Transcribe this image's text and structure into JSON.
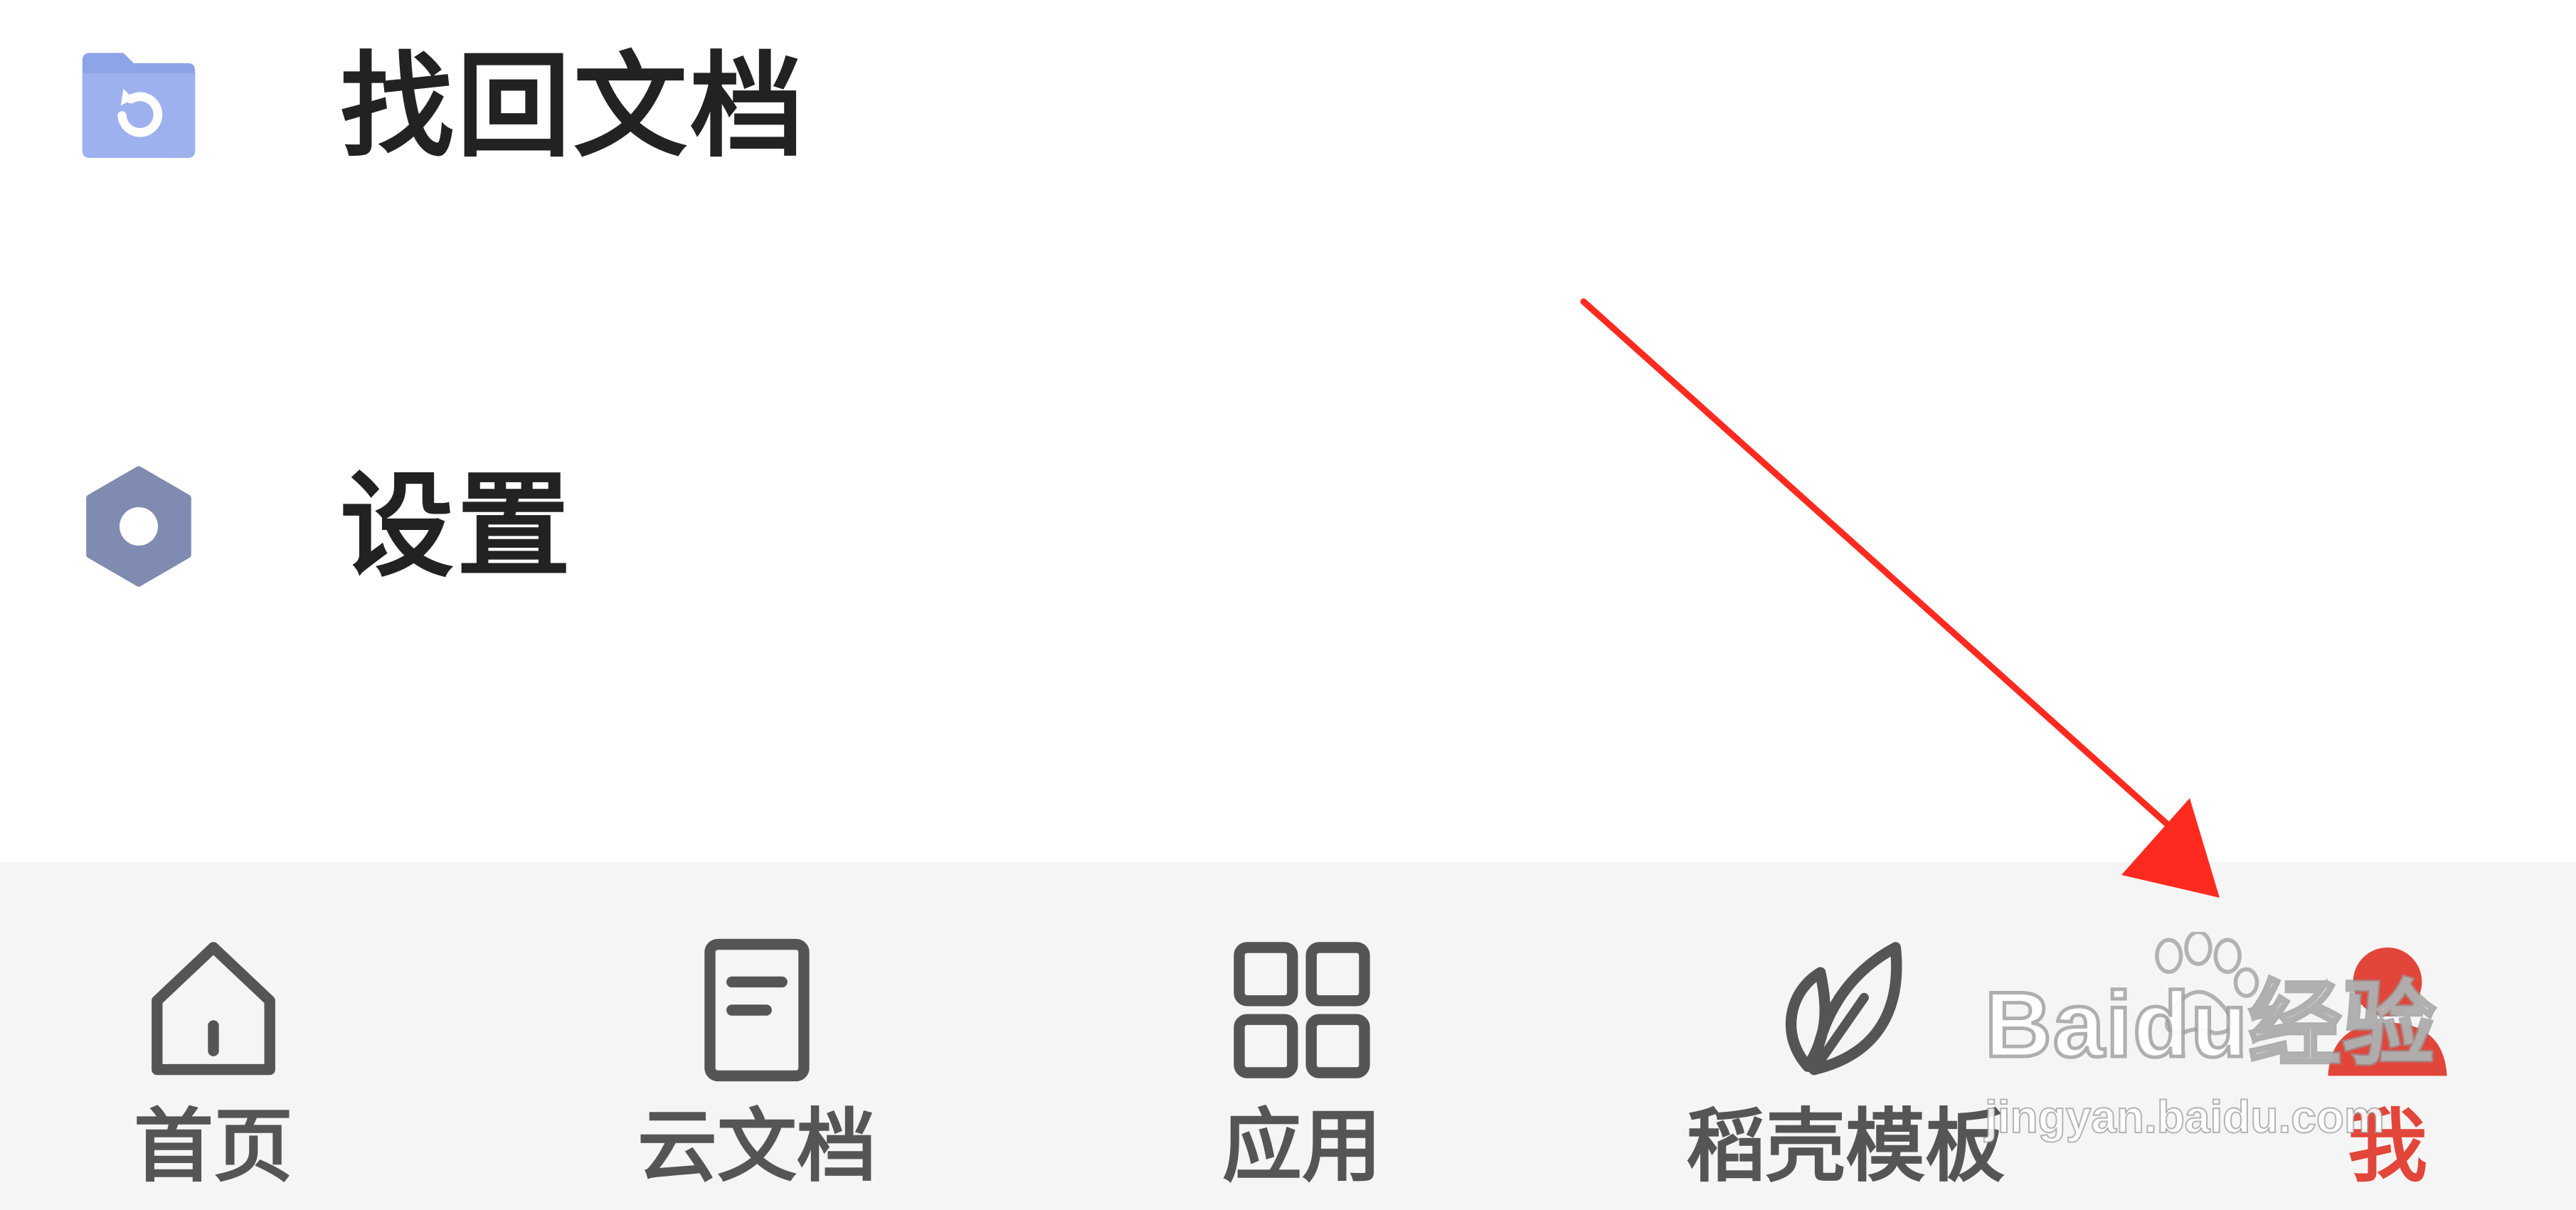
{
  "menu": {
    "items": [
      {
        "label": "找回文档",
        "icon": "folder-restore-icon",
        "icon_color": "#8ea4e8"
      },
      {
        "label": "设置",
        "icon": "hexagon-settings-icon",
        "icon_color": "#7f8bb0"
      }
    ]
  },
  "tabbar": {
    "tabs": [
      {
        "label": "首页",
        "icon": "home-icon",
        "active": false
      },
      {
        "label": "云文档",
        "icon": "cloud-document-icon",
        "active": false
      },
      {
        "label": "应用",
        "icon": "apps-grid-icon",
        "active": false
      },
      {
        "label": "稻壳模板",
        "icon": "leaf-template-icon",
        "active": false
      },
      {
        "label": "我",
        "icon": "user-profile-icon",
        "active": true
      }
    ],
    "active_color": "#e2463a",
    "inactive_color": "#555555"
  },
  "annotation": {
    "type": "red-arrow",
    "color": "#ff2a1f",
    "points_to": "tab-me"
  },
  "watermark": {
    "brand": "Baidu经验",
    "url": "jingyan.baidu.com",
    "icon": "paw-icon"
  }
}
